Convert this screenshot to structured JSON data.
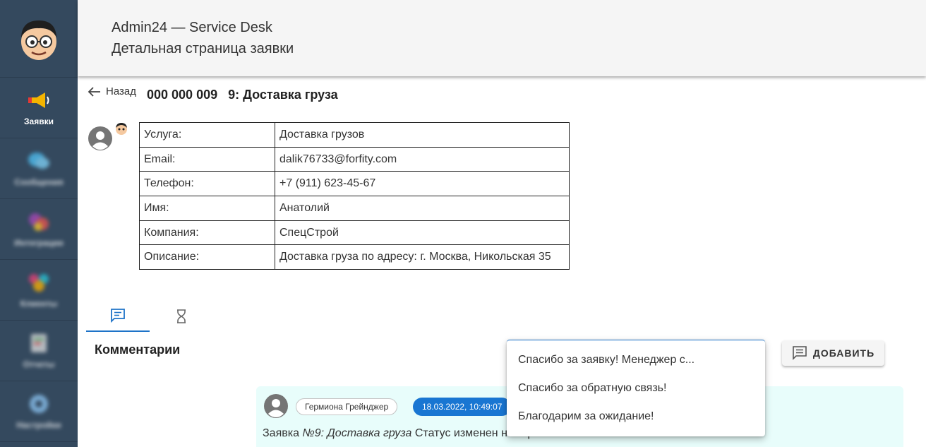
{
  "sidebar": {
    "items": [
      {
        "label": "Заявки",
        "icon": "megaphone-icon",
        "active": true
      },
      {
        "label": "Сообщения",
        "icon": "chat-bubbles-icon",
        "active": false
      },
      {
        "label": "Интеграции",
        "icon": "integrations-icon",
        "active": false
      },
      {
        "label": "Клиенты",
        "icon": "clients-icon",
        "active": false
      },
      {
        "label": "Отчеты",
        "icon": "reports-icon",
        "active": false
      },
      {
        "label": "Настройки",
        "icon": "settings-icon",
        "active": false
      }
    ]
  },
  "header": {
    "app_title": "Admin24 — Service Desk",
    "page_title": "Детальная страница заявки"
  },
  "ticket": {
    "back_label": "Назад",
    "title": "000 000 009   9: Доставка груза"
  },
  "info": {
    "rows": [
      {
        "key": "Услуга:",
        "value": "Доставка грузов"
      },
      {
        "key": "Email:",
        "value": "dalik76733@forfity.com"
      },
      {
        "key": "Телефон:",
        "value": "+7 (911) 623-45-67"
      },
      {
        "key": "Имя:",
        "value": "Анатолий"
      },
      {
        "key": "Компания:",
        "value": "СпецСтрой"
      },
      {
        "key": "Описание:",
        "value": "Доставка груза по адресу: г. Москва, Никольская 35"
      }
    ]
  },
  "tabs": [
    {
      "icon": "comment-icon",
      "active": true
    },
    {
      "icon": "hourglass-icon",
      "active": false
    }
  ],
  "comments": {
    "heading": "Комментарии",
    "add_label": "ДОБАВИТЬ",
    "templates": [
      "Спасибо за заявку! Менеджер с...",
      "Спасибо за обратную связь!",
      "Благодарим за ожидание!"
    ],
    "items": [
      {
        "author": "Гермиона Грейнджер",
        "date": "18.03.2022, 10:49:07",
        "text_prefix": "Заявка ",
        "text_italic": "№9: Доставка груза",
        "text_suffix": " Статус изменен на В работе"
      }
    ]
  },
  "colors": {
    "sidebar_bg": "#34495e",
    "accent": "#1976d2",
    "comment_bg": "#e8fdfb"
  }
}
